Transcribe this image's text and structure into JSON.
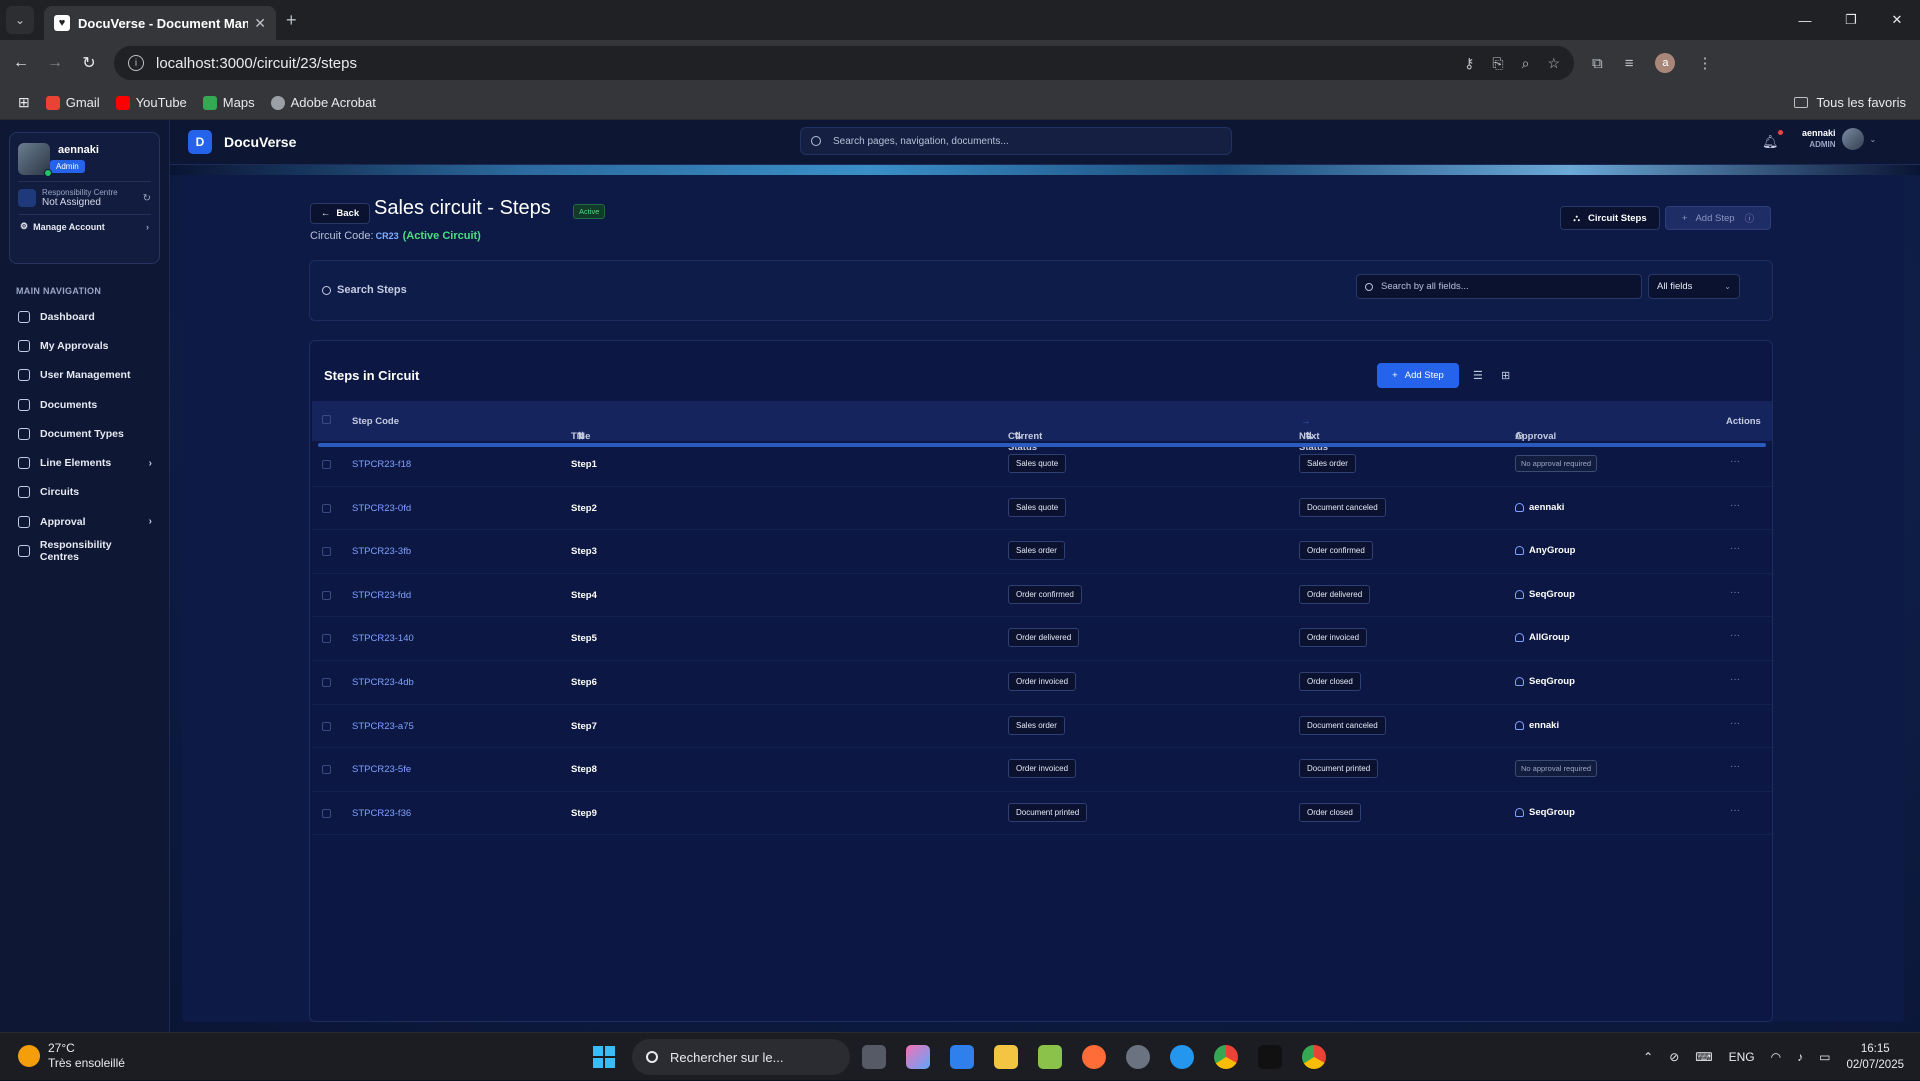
{
  "browser": {
    "tab_title": "DocuVerse - Document Manag",
    "url": "localhost:3000/circuit/23/steps",
    "bookmarks": [
      {
        "label": "Gmail",
        "color": "#ea4335"
      },
      {
        "label": "YouTube",
        "color": "#ff0000"
      },
      {
        "label": "Maps",
        "color": "#34a853"
      },
      {
        "label": "Adobe Acrobat",
        "color": "#9aa0a6"
      }
    ],
    "all_bookmarks": "Tous les favoris",
    "profile_initial": "a"
  },
  "sidebar": {
    "user": {
      "name": "aennaki",
      "role": "Admin"
    },
    "responsibility": {
      "label": "Responsibility Centre",
      "value": "Not Assigned"
    },
    "manage_account": "Manage Account",
    "nav_header": "MAIN NAVIGATION",
    "items": [
      {
        "label": "Dashboard",
        "icon": "dashboard-icon",
        "chevron": false
      },
      {
        "label": "My Approvals",
        "icon": "clipboard-check-icon",
        "chevron": false
      },
      {
        "label": "User Management",
        "icon": "users-icon",
        "chevron": false
      },
      {
        "label": "Documents",
        "icon": "document-icon",
        "chevron": false
      },
      {
        "label": "Document Types",
        "icon": "layers-icon",
        "chevron": false
      },
      {
        "label": "Line Elements",
        "icon": "box-icon",
        "chevron": true
      },
      {
        "label": "Circuits",
        "icon": "git-branch-icon",
        "chevron": false
      },
      {
        "label": "Approval",
        "icon": "user-check-icon",
        "chevron": true
      },
      {
        "label": "Responsibility Centres",
        "icon": "building-icon",
        "chevron": false
      }
    ]
  },
  "topbar": {
    "logo_letter": "D",
    "app_name": "DocuVerse",
    "search_placeholder": "Search pages, navigation, documents...",
    "user_name": "aennaki",
    "user_role": "ADMIN"
  },
  "page": {
    "back_label": "Back",
    "title": "Sales circuit - Steps",
    "status_badge": "Active",
    "circuit_code_label": "Circuit Code:",
    "circuit_code": "CR23",
    "active_label": "(Active Circuit)",
    "circuit_steps_button": "Circuit Steps",
    "add_step_header_button": "Add Step"
  },
  "search_panel": {
    "label": "Search Steps",
    "placeholder": "Search by all fields...",
    "filter_value": "All fields"
  },
  "table": {
    "title": "Steps in Circuit",
    "add_button": "Add Step",
    "columns": {
      "step_code": "Step Code",
      "title": "Title",
      "current_status": "Current Status",
      "next_status": "Next Status",
      "approval": "Approval",
      "actions": "Actions"
    },
    "rows": [
      {
        "code": "STPCR23-f18",
        "title": "Step1",
        "current": "Sales quote",
        "next": "Sales order",
        "approval": "No approval required",
        "approval_type": "none"
      },
      {
        "code": "STPCR23-0fd",
        "title": "Step2",
        "current": "Sales quote",
        "next": "Document canceled",
        "approval": "aennaki",
        "approval_type": "user"
      },
      {
        "code": "STPCR23-3fb",
        "title": "Step3",
        "current": "Sales order",
        "next": "Order confirmed",
        "approval": "AnyGroup",
        "approval_type": "group"
      },
      {
        "code": "STPCR23-fdd",
        "title": "Step4",
        "current": "Order confirmed",
        "next": "Order delivered",
        "approval": "SeqGroup",
        "approval_type": "group"
      },
      {
        "code": "STPCR23-140",
        "title": "Step5",
        "current": "Order delivered",
        "next": "Order invoiced",
        "approval": "AllGroup",
        "approval_type": "group"
      },
      {
        "code": "STPCR23-4db",
        "title": "Step6",
        "current": "Order invoiced",
        "next": "Order closed",
        "approval": "SeqGroup",
        "approval_type": "group"
      },
      {
        "code": "STPCR23-a75",
        "title": "Step7",
        "current": "Sales order",
        "next": "Document canceled",
        "approval": "ennaki",
        "approval_type": "user"
      },
      {
        "code": "STPCR23-5fe",
        "title": "Step8",
        "current": "Order invoiced",
        "next": "Document printed",
        "approval": "No approval required",
        "approval_type": "none"
      },
      {
        "code": "STPCR23-f36",
        "title": "Step9",
        "current": "Document printed",
        "next": "Order closed",
        "approval": "SeqGroup",
        "approval_type": "group"
      }
    ]
  },
  "taskbar": {
    "temperature": "27°C",
    "weather": "Très ensoleillé",
    "search_placeholder": "Rechercher sur le...",
    "language": "ENG",
    "time": "16:15",
    "date": "02/07/2025"
  }
}
